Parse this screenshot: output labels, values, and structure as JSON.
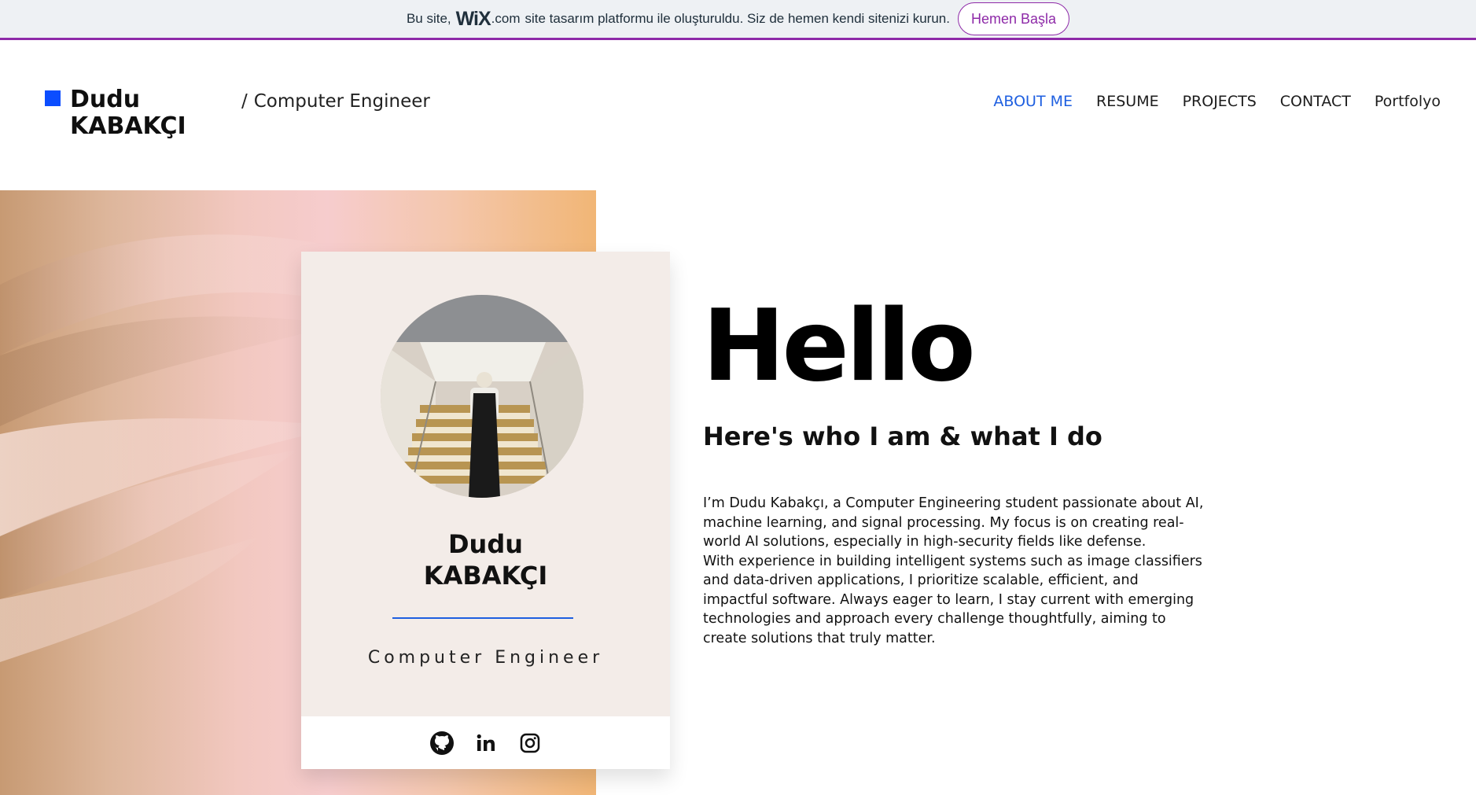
{
  "banner": {
    "text_before": "Bu site,",
    "wix_logo": "WiX",
    "wix_suffix": ".com",
    "text_after": "site tasarım platformu ile oluşturuldu. Siz de hemen kendi sitenizi kurun.",
    "cta_label": "Hemen Başla",
    "accent_color": "#8e2aa8"
  },
  "header": {
    "brand_first": "Dudu",
    "brand_last": "KABAKÇI",
    "brand_color": "#0b4dff",
    "tagline_slash": "/",
    "tagline": "Computer Engineer"
  },
  "nav": {
    "items": [
      {
        "label": "ABOUT ME",
        "active": true
      },
      {
        "label": "RESUME"
      },
      {
        "label": "PROJECTS"
      },
      {
        "label": "CONTACT"
      },
      {
        "label": "Portfolyo"
      }
    ],
    "active_color": "#1e5fe0"
  },
  "card": {
    "name_first": "Dudu",
    "name_last": "KABAKÇI",
    "role": "Computer Engineer",
    "socials": [
      "github-icon",
      "linkedin-icon",
      "instagram-icon"
    ]
  },
  "hero": {
    "title": "Hello",
    "subtitle": "Here's who I am & what I do",
    "bio_1": "I’m Dudu Kabakçı, a Computer Engineering student passionate about AI, machine learning, and signal processing. My focus is on creating real-world AI solutions, especially in high-security fields like defense.",
    "bio_2": "With experience in building intelligent systems such as image classifiers and data-driven applications, I prioritize scalable, efficient, and impactful software. Always eager to learn, I stay current with emerging technologies and approach every challenge thoughtfully, aiming to create solutions that truly matter."
  }
}
